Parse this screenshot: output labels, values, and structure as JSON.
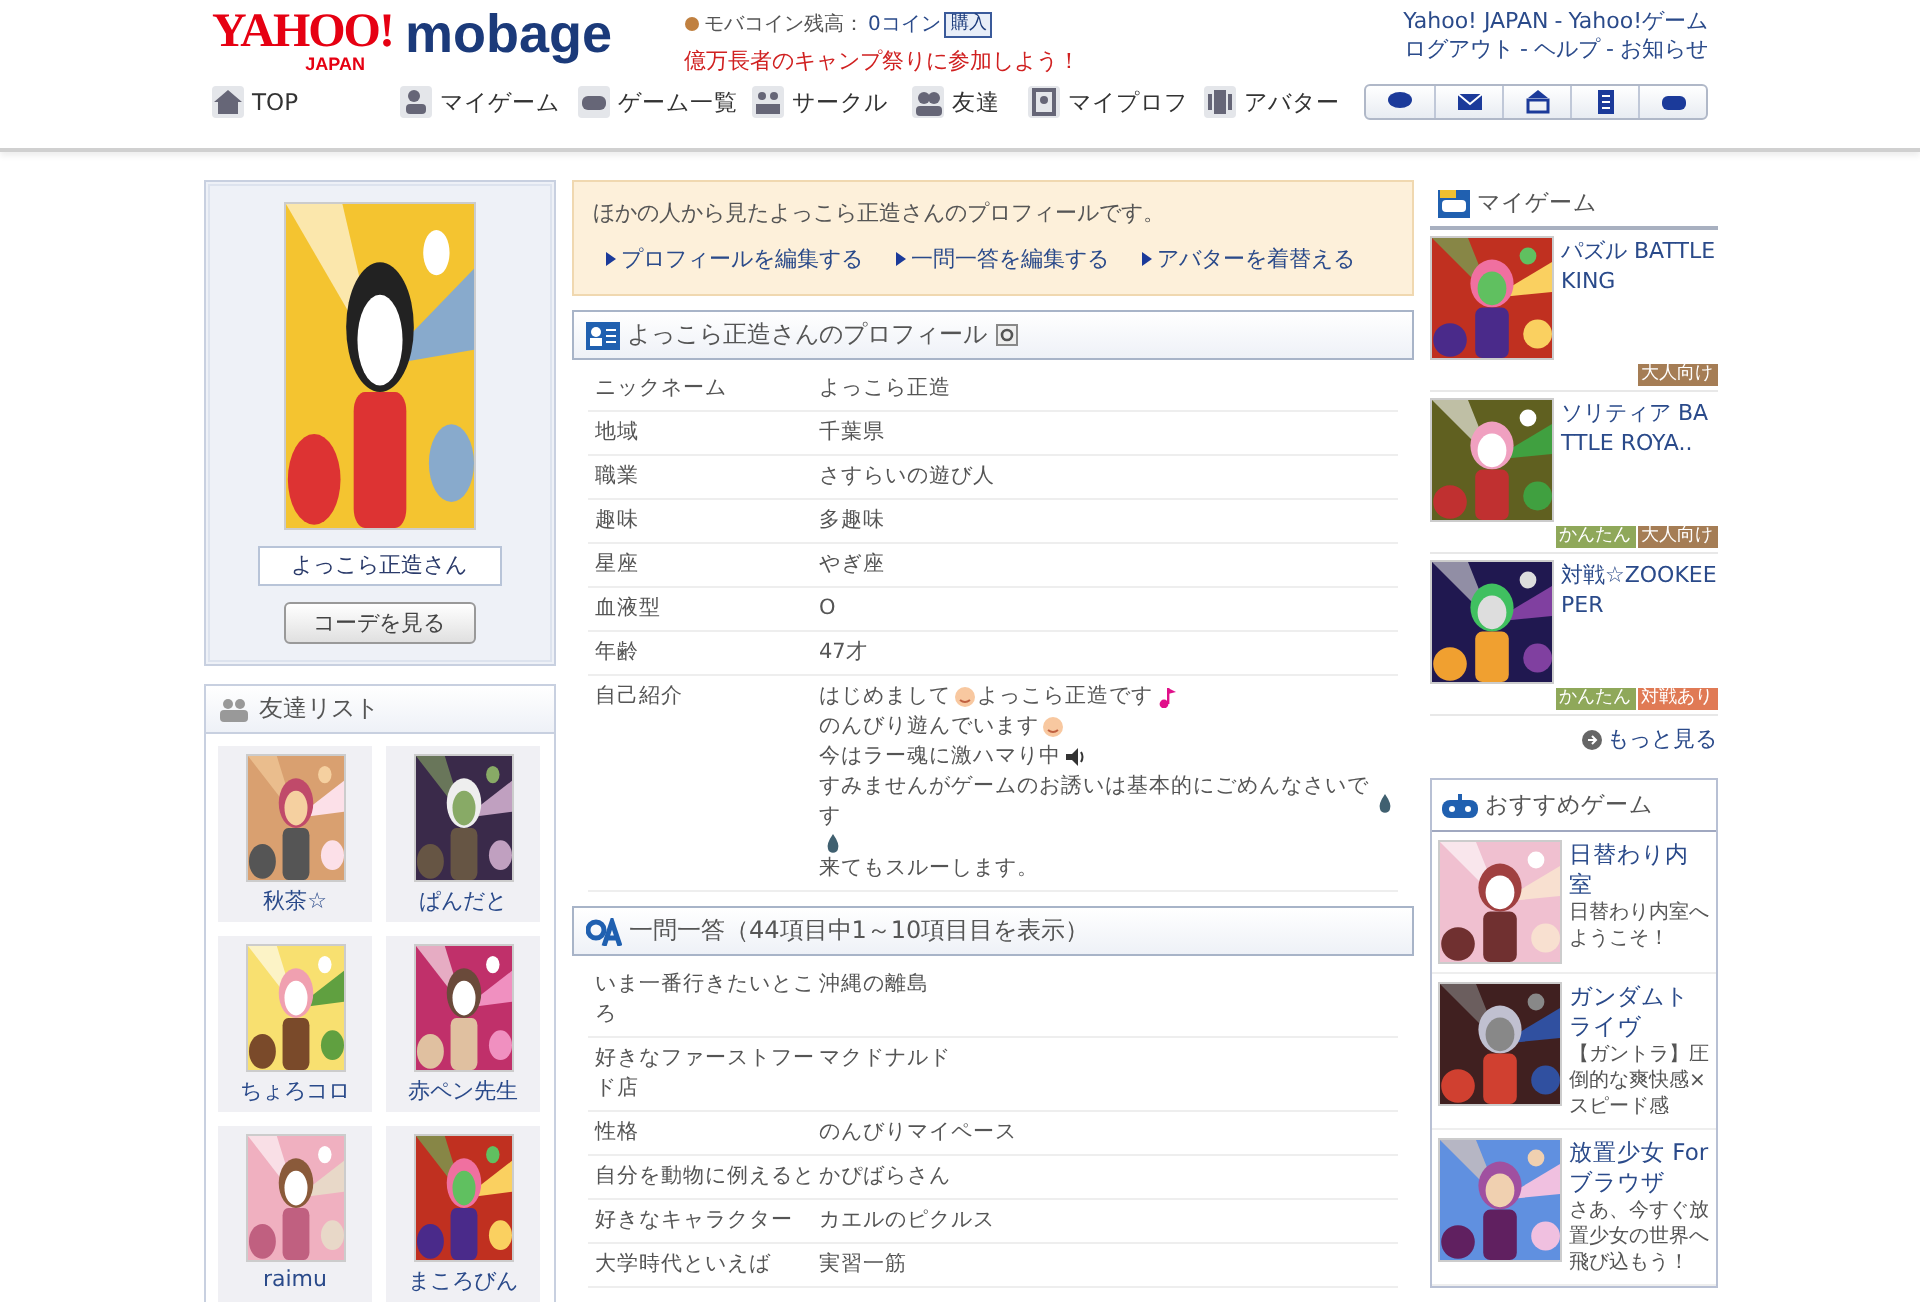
{
  "header": {
    "logo": {
      "yahoo": "YAHOO!",
      "japan": "JAPAN",
      "mobage": "mobage"
    },
    "coin_label": "モバコイン残高：",
    "coin_value": "0コイン",
    "buy_button": "購入",
    "campaign": "億万長者のキャンプ祭りに参加しよう！",
    "link_separator": "-",
    "top_links": [
      {
        "label": "Yahoo! JAPAN"
      },
      {
        "label": "Yahoo!ゲーム"
      }
    ],
    "account_links": [
      {
        "label": "ログアウト"
      },
      {
        "label": "ヘルプ"
      },
      {
        "label": "お知らせ"
      }
    ],
    "nav": [
      {
        "label": "TOP",
        "kind": "home"
      },
      {
        "label": "マイゲーム",
        "kind": "mygame"
      },
      {
        "label": "ゲーム一覧",
        "kind": "games"
      },
      {
        "label": "サークル",
        "kind": "circle"
      },
      {
        "label": "友達",
        "kind": "friends"
      },
      {
        "label": "マイプロフ",
        "kind": "profile"
      },
      {
        "label": "アバター",
        "kind": "avatar"
      }
    ],
    "tool_icons": [
      {
        "kind": "chat"
      },
      {
        "kind": "mail"
      },
      {
        "kind": "board"
      },
      {
        "kind": "diary"
      },
      {
        "kind": "game"
      }
    ]
  },
  "profile_card": {
    "name": "よっこら正造さん",
    "button": "コーデを見る"
  },
  "friends": {
    "title": "友達リスト",
    "items": [
      {
        "name": "秋茶☆"
      },
      {
        "name": "ぱんだと"
      },
      {
        "name": "ちょろコロ"
      },
      {
        "name": "赤ペン先生"
      },
      {
        "name": "raimu"
      },
      {
        "name": "まころびん"
      }
    ]
  },
  "notice": {
    "text": "ほかの人から見たよっこら正造さんのプロフィールです。",
    "links": [
      {
        "label": "プロフィールを編集する"
      },
      {
        "label": "一問一答を編集する"
      },
      {
        "label": "アバターを着替える"
      }
    ]
  },
  "profile": {
    "title": "よっこら正造さんのプロフィール",
    "rows": [
      {
        "label": "ニックネーム",
        "value": "よっこら正造"
      },
      {
        "label": "地域",
        "value": "千葉県"
      },
      {
        "label": "職業",
        "value": "さすらいの遊び人"
      },
      {
        "label": "趣味",
        "value": "多趣味"
      },
      {
        "label": "星座",
        "value": "やぎ座"
      },
      {
        "label": "血液型",
        "value": "O"
      },
      {
        "label": "年齢",
        "value": "47才"
      }
    ],
    "intro_label": "自己紹介",
    "intro_lines": [
      [
        {
          "kind": "text",
          "text": "はじめまして"
        },
        {
          "kind": "face"
        },
        {
          "kind": "text",
          "text": "よっこら正造です"
        },
        {
          "kind": "note"
        }
      ],
      [
        {
          "kind": "text",
          "text": "のんびり遊んでいます"
        },
        {
          "kind": "face"
        }
      ],
      [
        {
          "kind": "text",
          "text": "今はラー魂に激ハマり中"
        },
        {
          "kind": "speaker"
        }
      ],
      [
        {
          "kind": "text",
          "text": "すみませんがゲームのお誘いは基本的にごめんなさいです"
        },
        {
          "kind": "drop"
        }
      ],
      [
        {
          "kind": "drop"
        }
      ],
      [
        {
          "kind": "text",
          "text": "来てもスルーします。"
        }
      ]
    ]
  },
  "qa": {
    "title": "一問一答（44項目中1～10項目目を表示）",
    "rows": [
      {
        "label": "いま一番行きたいところ",
        "value": "沖縄の離島"
      },
      {
        "label": "好きなファーストフード店",
        "value": "マクドナルド"
      },
      {
        "label": "性格",
        "value": "のんびりマイペース"
      },
      {
        "label": "自分を動物に例えると",
        "value": "かぴばらさん"
      },
      {
        "label": "好きなキャラクター",
        "value": "カエルのピクルス"
      },
      {
        "label": "大学時代といえば",
        "value": "実習一筋"
      }
    ]
  },
  "my_games": {
    "title": "マイゲーム",
    "items": [
      {
        "title": "パズル BATTLE KING",
        "tags": [
          {
            "label": "大人向け",
            "color": "#a57d55"
          }
        ]
      },
      {
        "title": "ソリティア BATTLE ROYA..",
        "tags": [
          {
            "label": "かんたん",
            "color": "#8fa85a"
          },
          {
            "label": "大人向け",
            "color": "#a57d55"
          }
        ]
      },
      {
        "title": "対戦☆ZOOKEEPER",
        "tags": [
          {
            "label": "かんたん",
            "color": "#8fa85a"
          },
          {
            "label": "対戦あり",
            "color": "#e07a55"
          }
        ]
      }
    ],
    "more": "もっと見る"
  },
  "recommended": {
    "title": "おすすめゲーム",
    "items": [
      {
        "title": "日替わり内室",
        "desc": "日替わり内室へようこそ！"
      },
      {
        "title": "ガンダムトライヴ",
        "desc": "【ガントラ】圧倒的な爽快感×スピード感"
      },
      {
        "title": "放置少女 For ブラウザ",
        "desc": "さあ、今すぐ放置少女の世界へ飛び込もう！"
      }
    ]
  }
}
